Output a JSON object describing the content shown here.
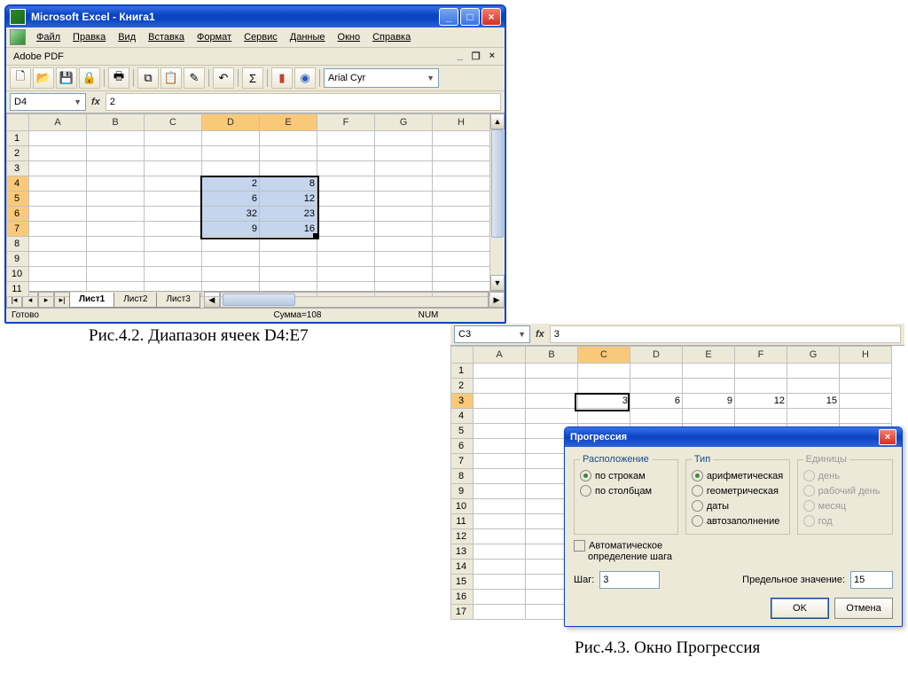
{
  "win1": {
    "title": "Microsoft Excel - Книга1",
    "menu": [
      "Файл",
      "Правка",
      "Вид",
      "Вставка",
      "Формат",
      "Сервис",
      "Данные",
      "Окно",
      "Справка"
    ],
    "adobe": "Adobe PDF",
    "font": "Arial Cyr",
    "namebox": "D4",
    "formula": "2",
    "cols": [
      "A",
      "B",
      "C",
      "D",
      "E",
      "F",
      "G",
      "H"
    ],
    "rows": [
      "1",
      "2",
      "3",
      "4",
      "5",
      "6",
      "7",
      "8",
      "9",
      "10",
      "11"
    ],
    "sel_rows": [
      "4",
      "5",
      "6",
      "7"
    ],
    "sel_cols": [
      "D",
      "E"
    ],
    "data": {
      "D4": "2",
      "E4": "8",
      "D5": "6",
      "E5": "12",
      "D6": "32",
      "E6": "23",
      "D7": "9",
      "E7": "16"
    },
    "sheets": [
      "Лист1",
      "Лист2",
      "Лист3"
    ],
    "status_ready": "Готово",
    "status_sum": "Сумма=108",
    "status_num": "NUM"
  },
  "caption1": "Рис.4.2. Диапазон ячеек D4:E7",
  "panel2": {
    "namebox": "C3",
    "formula": "3",
    "cols": [
      "A",
      "B",
      "C",
      "D",
      "E",
      "F",
      "G",
      "H"
    ],
    "rows": [
      "1",
      "2",
      "3",
      "4",
      "5",
      "6",
      "7",
      "8",
      "9",
      "10",
      "11",
      "12",
      "13",
      "14",
      "15",
      "16",
      "17"
    ],
    "sel_col": "C",
    "sel_row": "3",
    "data": {
      "C3": "3",
      "D3": "6",
      "E3": "9",
      "F3": "12",
      "G3": "15"
    }
  },
  "dialog": {
    "title": "Прогрессия",
    "grp_layout": "Расположение",
    "r_rows": "по строкам",
    "r_cols": "по столбцам",
    "chk_auto1": "Автоматическое",
    "chk_auto2": "определение шага",
    "grp_type": "Тип",
    "r_arith": "арифметическая",
    "r_geom": "геометрическая",
    "r_dates": "даты",
    "r_autofill": "автозаполнение",
    "grp_units": "Единицы",
    "r_day": "день",
    "r_wday": "рабочий день",
    "r_month": "месяц",
    "r_year": "год",
    "lbl_step": "Шаг:",
    "val_step": "3",
    "lbl_limit": "Предельное значение:",
    "val_limit": "15",
    "btn_ok": "OK",
    "btn_cancel": "Отмена"
  },
  "caption2": "Рис.4.3. Окно Прогрессия"
}
